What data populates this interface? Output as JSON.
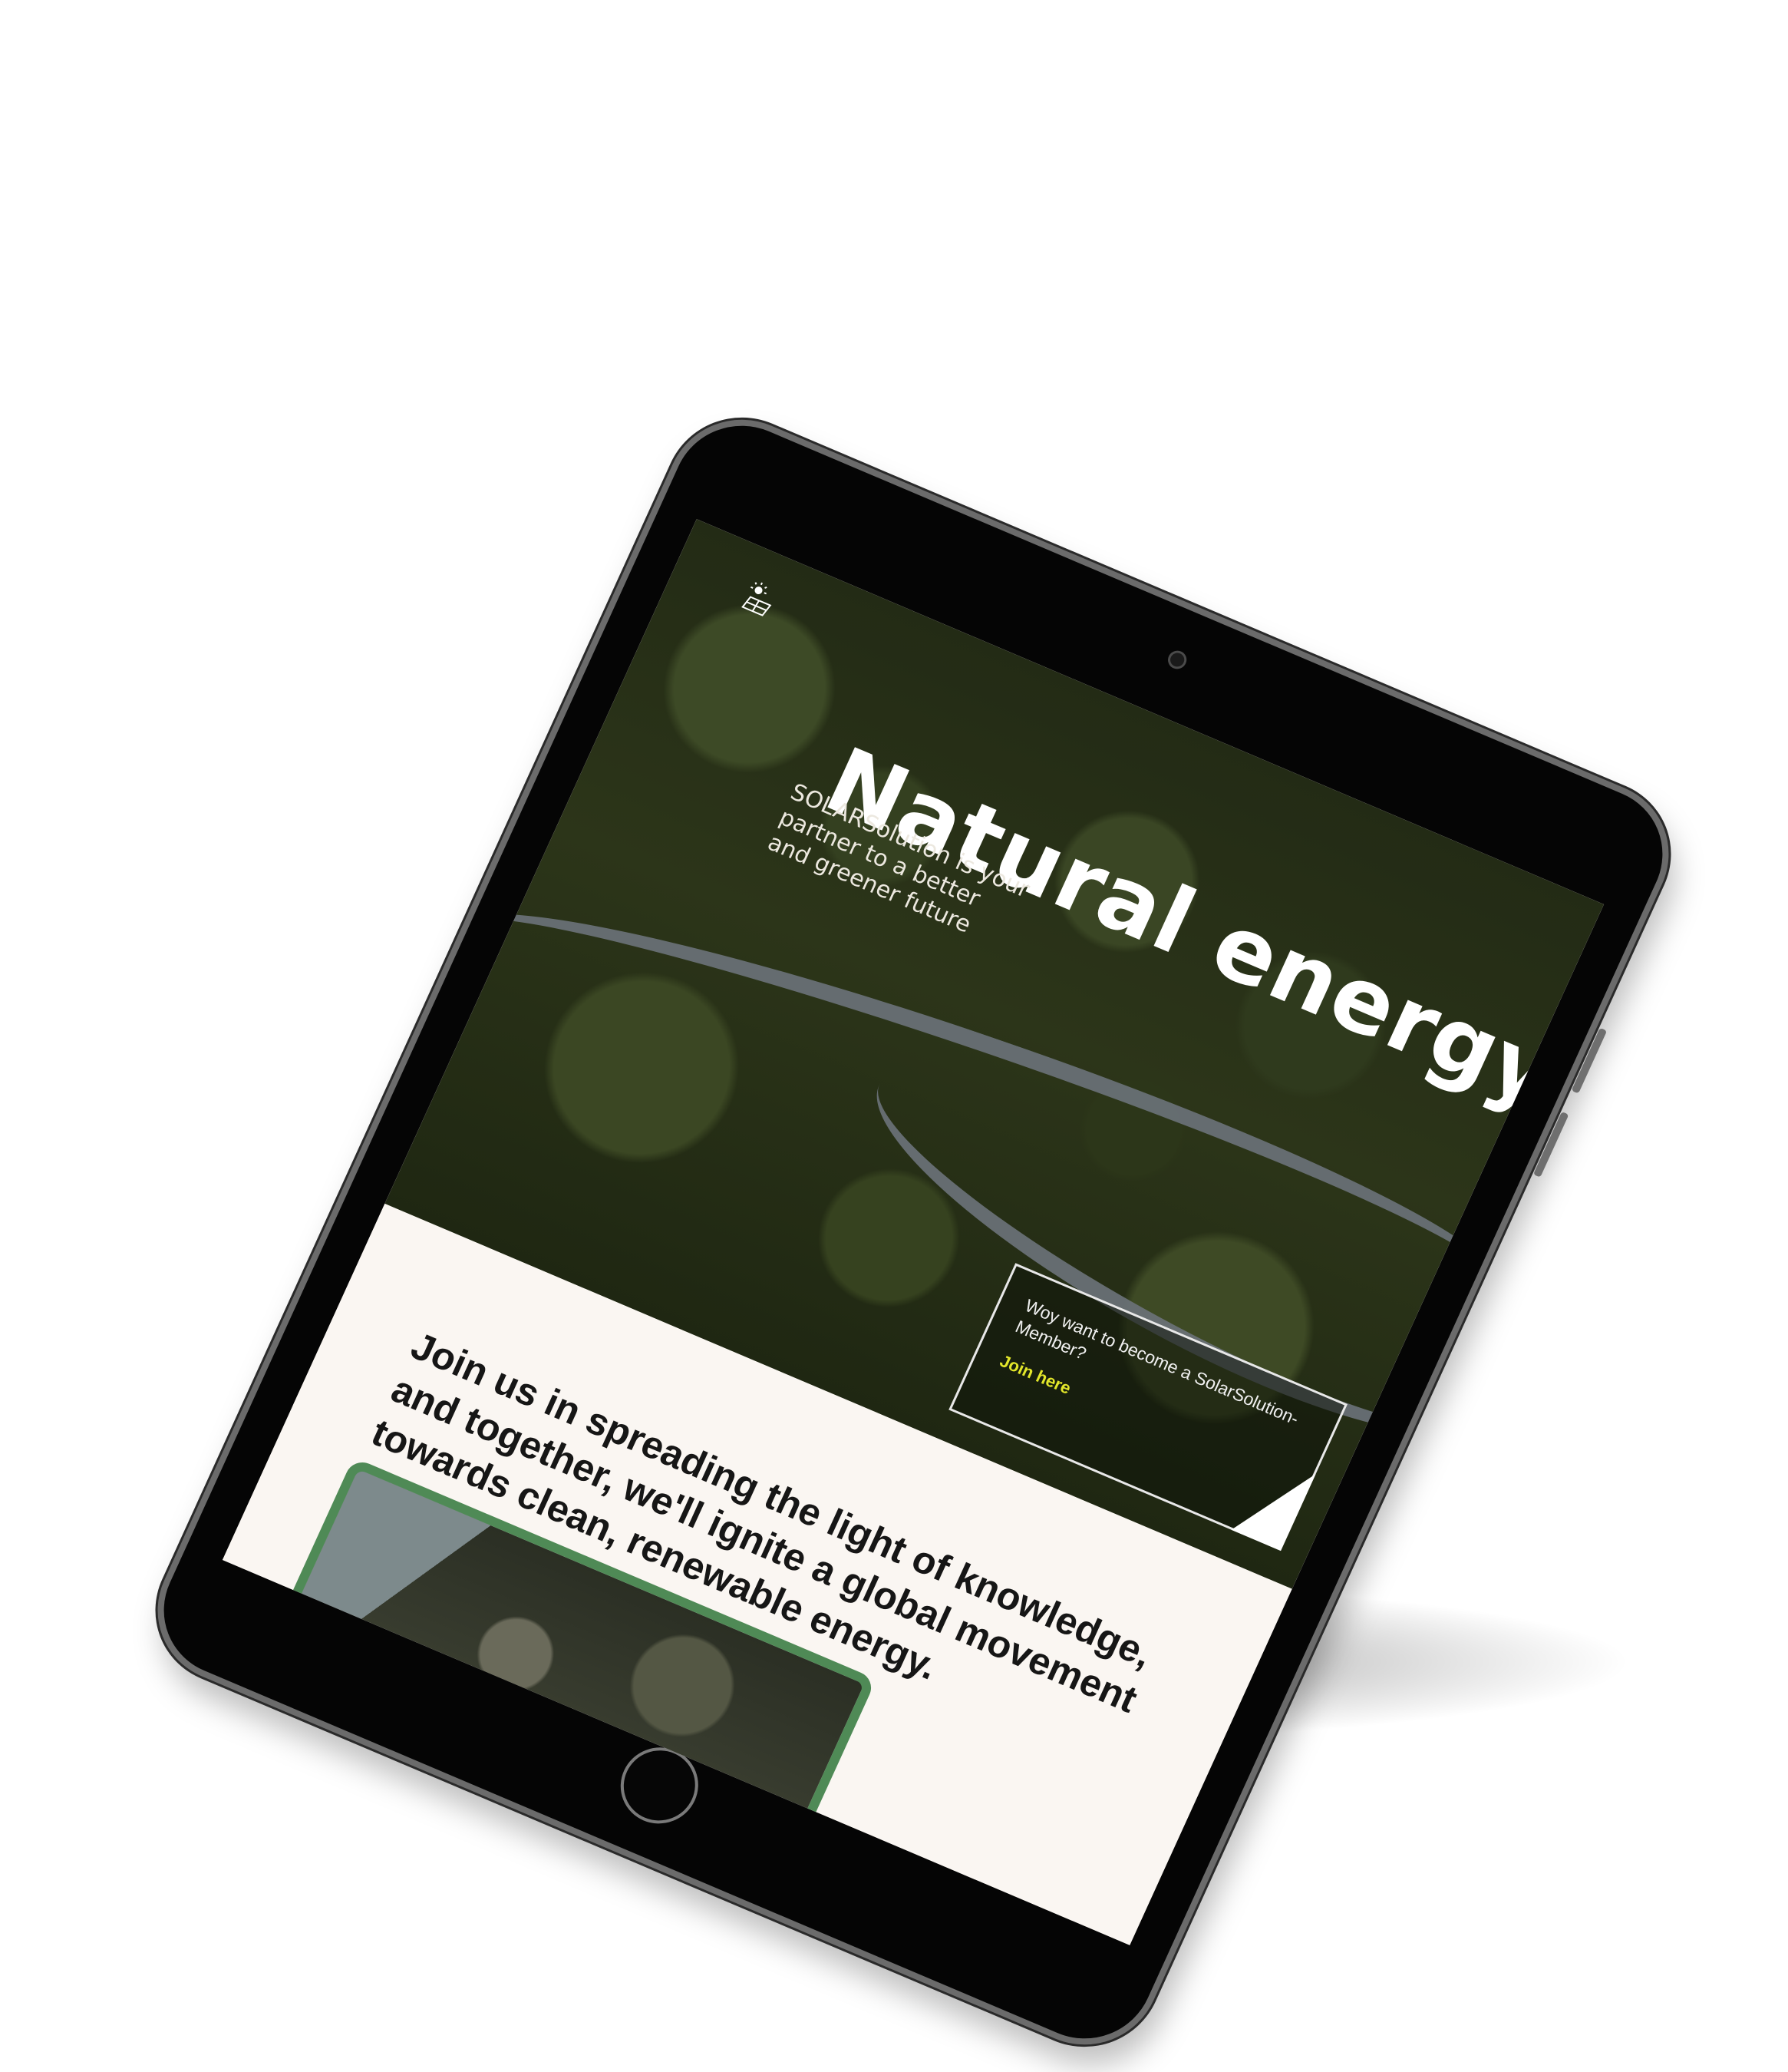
{
  "hero": {
    "title": "Natural energy",
    "subtitle": "SOLARSolution is your partner to a better and greener future"
  },
  "join_card": {
    "question": "Woy want to become a SolarSolution-Member?",
    "link_label": "Join here",
    "link_color": "#e2e62a"
  },
  "tagline": "Join us in spreading the light of knowledge, and together, we'll ignite a global movement towards clean, renewable energy.",
  "icons": {
    "logo": "sun-solar-panel-icon",
    "camera": "camera-icon",
    "home": "home-button"
  },
  "colors": {
    "forest": "#2c3519",
    "light_bg": "#faf6f2",
    "card_frame": "#4f8a56",
    "bezel": "#050505"
  }
}
